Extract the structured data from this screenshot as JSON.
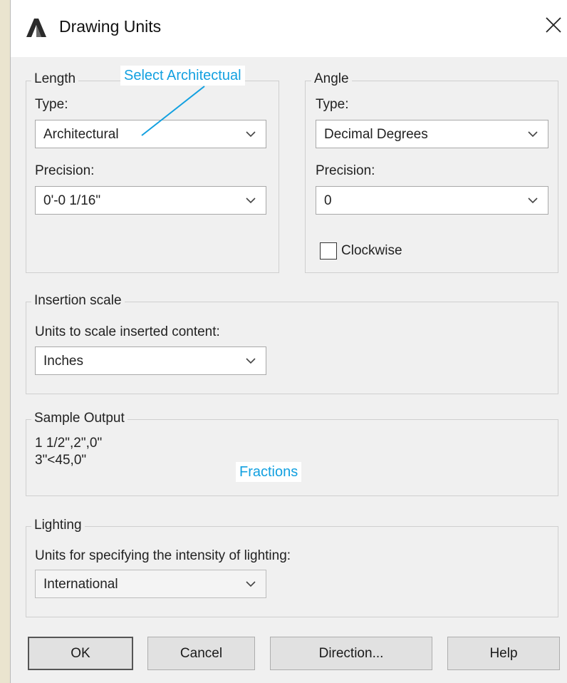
{
  "window": {
    "title": "Drawing Units",
    "app_icon": "autocad-a-icon",
    "close_icon": "close-icon"
  },
  "length": {
    "legend": "Length",
    "type_label": "Type:",
    "type_value": "Architectural",
    "precision_label": "Precision:",
    "precision_value": "0'-0 1/16\""
  },
  "angle": {
    "legend": "Angle",
    "type_label": "Type:",
    "type_value": "Decimal Degrees",
    "precision_label": "Precision:",
    "precision_value": "0",
    "clockwise_label": "Clockwise",
    "clockwise_checked": false
  },
  "insertion": {
    "legend": "Insertion scale",
    "units_label": "Units to scale inserted content:",
    "units_value": "Inches"
  },
  "sample": {
    "legend": "Sample Output",
    "line1": "1 1/2\",2\",0\"",
    "line2": "3\"<45,0\""
  },
  "lighting": {
    "legend": "Lighting",
    "units_label": "Units for specifying the intensity of lighting:",
    "units_value": "International"
  },
  "annotations": {
    "select_architectual": "Select Architectual",
    "fractions": "Fractions",
    "color": "#12a0e0"
  },
  "buttons": {
    "ok": "OK",
    "cancel": "Cancel",
    "direction": "Direction...",
    "help": "Help"
  }
}
